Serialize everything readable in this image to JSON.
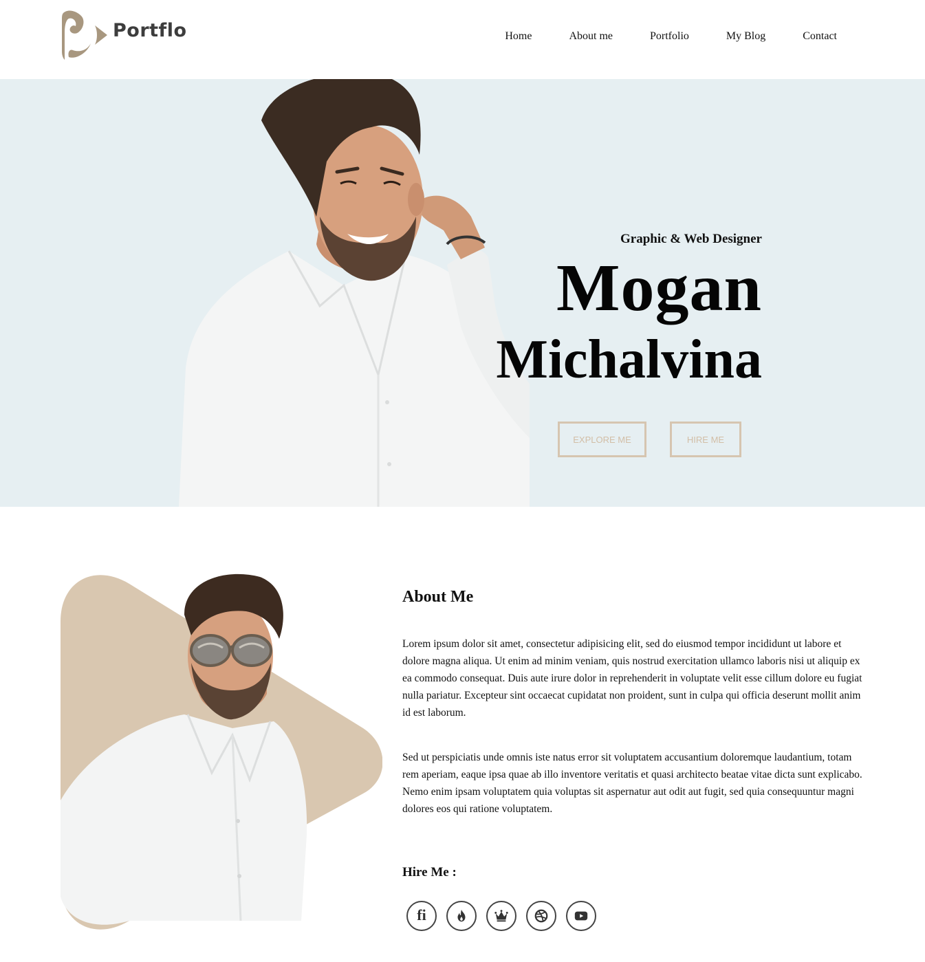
{
  "brand": {
    "name": "Portflo",
    "accent_color": "#a8977f",
    "dark_color": "#3d3d3d"
  },
  "nav": {
    "items": [
      {
        "label": "Home"
      },
      {
        "label": "About me"
      },
      {
        "label": "Portfolio"
      },
      {
        "label": "My Blog"
      },
      {
        "label": "Contact"
      }
    ]
  },
  "hero": {
    "subtitle": "Graphic & Web Designer",
    "first_name": "Mogan",
    "last_name": "Michalvina",
    "explore_label": "EXPLORE ME",
    "hire_label": "HIRE ME",
    "background": "#e6eff2",
    "button_color": "#d6c5b0"
  },
  "about": {
    "title": "About Me",
    "paragraph1": "Lorem ipsum dolor sit amet, consectetur adipisicing elit, sed do eiusmod tempor incididunt ut labore et dolore magna aliqua. Ut enim ad minim veniam, quis nostrud exercitation ullamco laboris nisi ut aliquip ex ea commodo consequat. Duis aute irure dolor in reprehenderit in voluptate velit esse cillum dolore eu fugiat nulla pariatur. Excepteur sint occaecat cupidatat non proident, sunt in culpa qui officia deserunt mollit anim id est laborum.",
    "paragraph2": "Sed ut perspiciatis unde omnis iste natus error sit voluptatem accusantium doloremque laudantium, totam rem aperiam, eaque ipsa quae ab illo inventore veritatis et quasi architecto beatae vitae dicta sunt explicabo. Nemo enim ipsam voluptatem quia voluptas sit aspernatur aut odit aut fugit, sed quia consequuntur magni dolores eos qui ratione voluptatem.",
    "shape_color": "#d9c7b0"
  },
  "hire": {
    "title": "Hire Me :",
    "socials": [
      {
        "icon": "fiverr-icon",
        "glyph": "fi"
      },
      {
        "icon": "fire-icon"
      },
      {
        "icon": "crown-icon"
      },
      {
        "icon": "dribbble-icon"
      },
      {
        "icon": "youtube-icon"
      }
    ]
  }
}
